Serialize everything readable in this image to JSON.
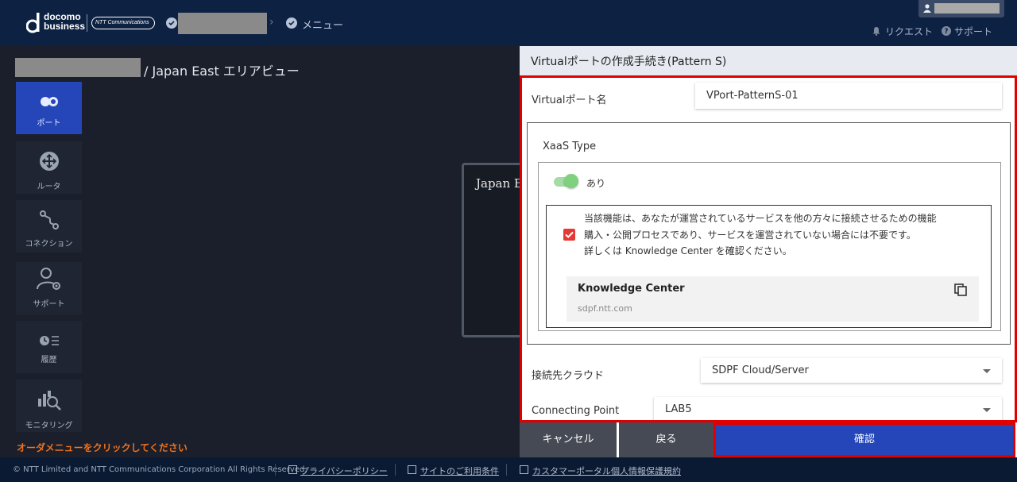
{
  "header": {
    "brand_line1": "docomo",
    "brand_line2": "business",
    "partner_logo": "NTT Communications",
    "breadcrumb_menu": "メニュー",
    "links": {
      "request": "リクエスト",
      "support": "サポート"
    }
  },
  "area": {
    "title_suffix": "/ Japan East エリアビュー",
    "canvas_label": "Japan E"
  },
  "sidebar": {
    "items": [
      {
        "label": "ポート",
        "icon": "port-icon",
        "active": true
      },
      {
        "label": "ルータ",
        "icon": "router-icon",
        "active": false
      },
      {
        "label": "コネクション",
        "icon": "connection-icon",
        "active": false
      },
      {
        "label": "サポート",
        "icon": "support-icon",
        "active": false
      },
      {
        "label": "履歴",
        "icon": "history-icon",
        "active": false
      },
      {
        "label": "モニタリング",
        "icon": "monitoring-icon",
        "active": false
      }
    ],
    "order_hint": "オーダメニューをクリックしてください"
  },
  "panel": {
    "title": "Virtualポートの作成手続き(Pattern S)",
    "vport_name_label": "Virtualポート名",
    "vport_name_value": "VPort-PatternS-01",
    "xaas_type_label": "XaaS Type",
    "toggle_label": "あり",
    "notice_lines": [
      "当該機能は、あなたが運営されているサービスを他の方々に接続させるための機能",
      "購入・公開プロセスであり、サービスを運営されていない場合には不要です。",
      "詳しくは Knowledge Center を確認ください。"
    ],
    "kc_title": "Knowledge Center",
    "kc_url": "sdpf.ntt.com",
    "cloud_label": "接続先クラウド",
    "cloud_value": "SDPF Cloud/Server",
    "cp_label": "Connecting Point",
    "cp_value": "LAB5",
    "buttons": {
      "cancel": "キャンセル",
      "back": "戻る",
      "confirm": "確認"
    }
  },
  "footer": {
    "copyright": "© NTT Limited and NTT Communications Corporation All Rights Reserved.",
    "privacy": "プライバシーポリシー",
    "terms": "サイトのご利用条件",
    "portal_privacy": "カスタマーポータル個人情報保護規約"
  },
  "colors": {
    "accent": "#2446b8",
    "highlight_border": "#e00000",
    "hint": "#f0721e",
    "header_bg": "#0d2142"
  }
}
